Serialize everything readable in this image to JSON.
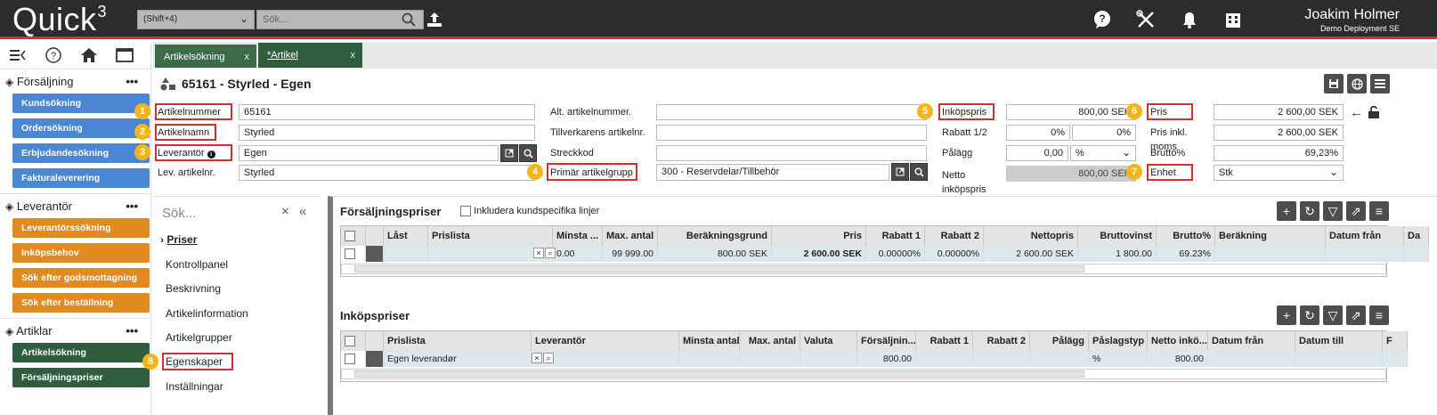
{
  "app": {
    "logo": "Quick",
    "logo_sup": "3",
    "shortcut": "(Shift+4)",
    "search_placeholder": "Sök..."
  },
  "user": {
    "name": "Joakim Holmer",
    "deployment": "Demo Deployment SE"
  },
  "sidebar": {
    "sections": [
      {
        "title": "Försäljning",
        "items": [
          "Kundsökning",
          "Ordersökning",
          "Erbjudandesökning",
          "Fakturaleverering"
        ]
      },
      {
        "title": "Leverantör",
        "items": [
          "Leverantörssökning",
          "Inköpsbehov",
          "Sök efter godsmottagning",
          "Sök efter beställning"
        ]
      },
      {
        "title": "Artiklar",
        "items": [
          "Artikelsökning",
          "Försäljningspriser"
        ]
      }
    ],
    "more": "•••"
  },
  "tabs": [
    {
      "label": "Artikelsökning",
      "close": "x"
    },
    {
      "label": "*Artikel",
      "close": "x"
    }
  ],
  "article": {
    "title": "65161 - Styrled - Egen",
    "labels": {
      "artnr": "Artikelnummer",
      "artnamn": "Artikelnamn",
      "lev": "Leverantör",
      "levart": "Lev. artikelnr.",
      "altart": "Alt. artikelnummer.",
      "tillv": "Tillverkarens artikelnr.",
      "streck": "Streckkod",
      "primar": "Primär artikelgrupp",
      "inkop": "Inköpspris",
      "rabatt": "Rabatt 1/2",
      "palagg": "Pålägg",
      "netto": "Netto inköpspris",
      "pris": "Pris",
      "prisinkl": "Pris inkl. moms",
      "brutto": "Brutto%",
      "enhet": "Enhet"
    },
    "values": {
      "artnr": "65161",
      "artnamn": "Styrled",
      "lev": "Egen",
      "levart": "Styrled",
      "altart": "",
      "tillv": "",
      "streck": "",
      "primar": "300 - Reservdelar/Tillbehör",
      "inkop": "800,00  SEK",
      "rabatt1": "0%",
      "rabatt2": "0%",
      "palagg": "0,00",
      "palagg_unit": "%",
      "netto": "800,00  SEK",
      "pris": "2 600,00  SEK",
      "prisinkl": "2 600,00  SEK",
      "brutto": "69,23%",
      "enhet": "Stk"
    },
    "badges": [
      "1",
      "2",
      "3",
      "4",
      "5",
      "6",
      "7",
      "8"
    ]
  },
  "nav": {
    "search_placeholder": "Sök...",
    "items": [
      "Priser",
      "Kontrollpanel",
      "Beskrivning",
      "Artikelinformation",
      "Artikelgrupper",
      "Egenskaper",
      "Inställningar"
    ]
  },
  "sales_prices": {
    "title": "Försäljningspriser",
    "include_label": "Inkludera kundspecifika linjer",
    "columns": [
      "Låst",
      "Prislista",
      "Minsta ...",
      "Max. antal",
      "Beräkningsgrund",
      "Pris",
      "Rabatt 1",
      "Rabatt 2",
      "Nettopris",
      "Bruttovinst",
      "Brutto%",
      "Beräkning",
      "Datum från",
      "Da"
    ],
    "row": [
      "",
      "",
      "0.00",
      "99 999.00",
      "800.00 SEK",
      "2 600.00 SEK",
      "0.00000%",
      "0.00000%",
      "2 600.00 SEK",
      "1 800.00",
      "69.23%",
      "",
      "",
      ""
    ]
  },
  "purchase_prices": {
    "title": "Inköpspriser",
    "columns": [
      "Prislista",
      "Leverantör",
      "Minsta antal",
      "Max. antal",
      "Valuta",
      "Försäljnin...",
      "Rabatt 1",
      "Rabatt 2",
      "Pålägg",
      "Påslagstyp",
      "Netto inkö...",
      "Datum från",
      "Datum till",
      "F"
    ],
    "row": [
      "Egen leverandør",
      "",
      "",
      "",
      "",
      "800.00",
      "",
      "",
      "",
      "%",
      "800.00",
      "",
      "",
      ""
    ]
  }
}
